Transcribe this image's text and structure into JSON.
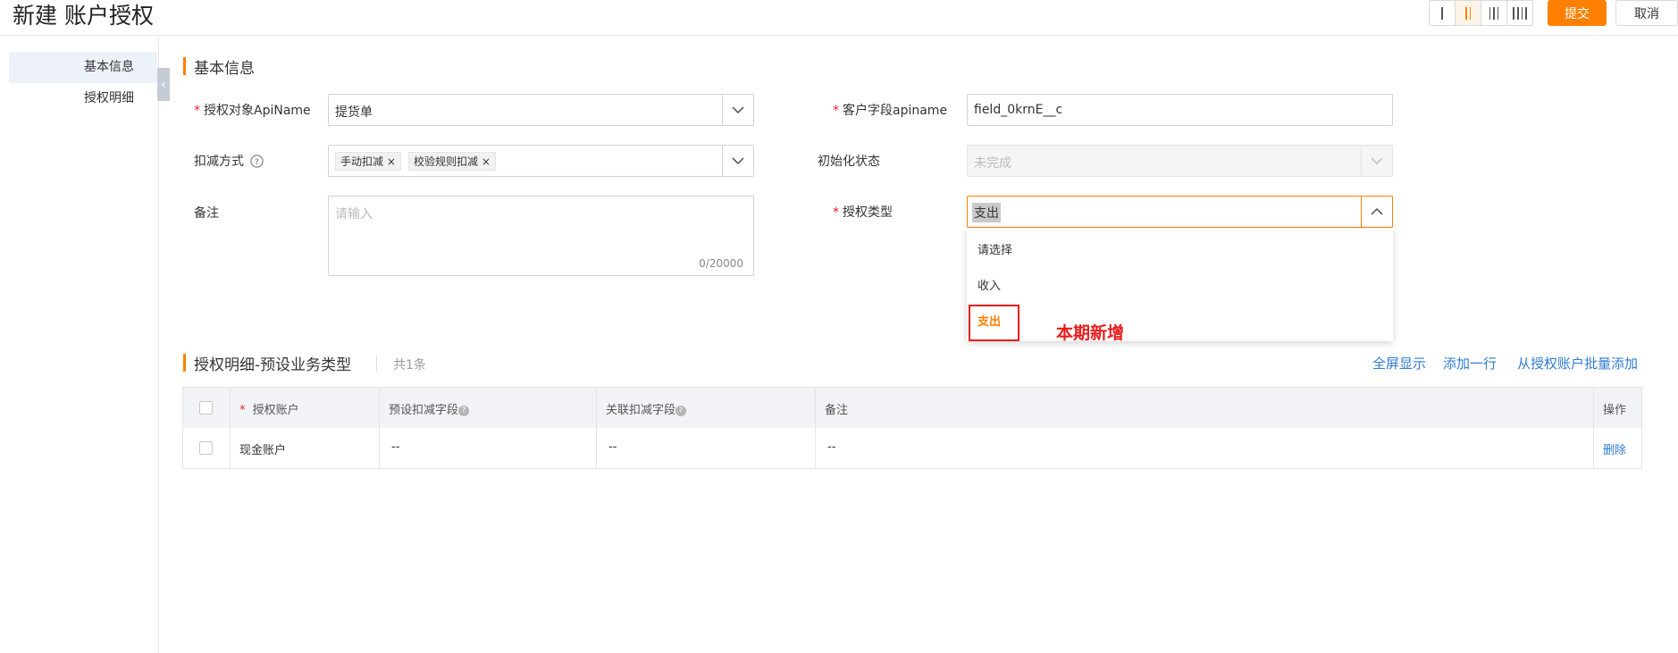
{
  "header": {
    "title": "新建 账户授权",
    "submit_label": "提交",
    "cancel_label": "取消"
  },
  "sidebar": {
    "items": [
      {
        "label": "基本信息",
        "active": true
      },
      {
        "label": "授权明细",
        "active": false
      }
    ]
  },
  "basic": {
    "section_title": "基本信息",
    "auth_object": {
      "label": "授权对象ApiName",
      "value": "提货单"
    },
    "customer_field": {
      "label": "客户字段apiname",
      "value": "field_0krnE__c"
    },
    "deduct_method": {
      "label": "扣减方式",
      "tags": [
        "手动扣减",
        "校验规则扣减"
      ]
    },
    "init_status": {
      "label": "初始化状态",
      "value": "未完成"
    },
    "remark": {
      "label": "备注",
      "placeholder": "请输入",
      "counter": "0/20000"
    },
    "auth_type": {
      "label": "授权类型",
      "value": "支出",
      "options": [
        "请选择",
        "收入",
        "支出"
      ]
    }
  },
  "annotation": {
    "text": "本期新增"
  },
  "detail": {
    "section_title": "授权明细-预设业务类型",
    "count": "共1条",
    "actions": [
      "全屏显示",
      "添加一行",
      "从授权账户批量添加"
    ],
    "columns": [
      "授权账户",
      "预设扣减字段",
      "关联扣减字段",
      "备注",
      "操作"
    ],
    "rows": [
      {
        "account": "现金账户",
        "preset": "--",
        "related": "--",
        "remark": "--",
        "op": "删除"
      }
    ]
  },
  "colors": {
    "accent": "#ff8000",
    "link": "#2f7cd6",
    "danger": "#e81d1d",
    "required": "#f5222d"
  }
}
